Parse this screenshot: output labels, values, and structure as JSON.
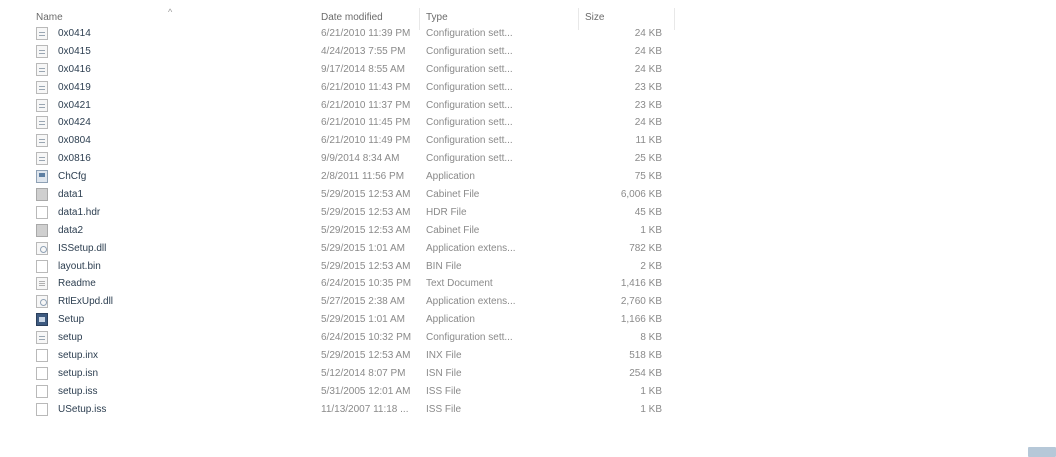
{
  "header": {
    "name": "Name",
    "date_modified": "Date modified",
    "type": "Type",
    "size": "Size",
    "sort_indicator": "^"
  },
  "files": [
    {
      "name": "0x0414",
      "date": "6/21/2010 11:39 PM",
      "type": "Configuration sett...",
      "size": "24 KB",
      "icon": "cfg"
    },
    {
      "name": "0x0415",
      "date": "4/24/2013 7:55 PM",
      "type": "Configuration sett...",
      "size": "24 KB",
      "icon": "cfg"
    },
    {
      "name": "0x0416",
      "date": "9/17/2014 8:55 AM",
      "type": "Configuration sett...",
      "size": "24 KB",
      "icon": "cfg"
    },
    {
      "name": "0x0419",
      "date": "6/21/2010 11:43 PM",
      "type": "Configuration sett...",
      "size": "23 KB",
      "icon": "cfg"
    },
    {
      "name": "0x0421",
      "date": "6/21/2010 11:37 PM",
      "type": "Configuration sett...",
      "size": "23 KB",
      "icon": "cfg"
    },
    {
      "name": "0x0424",
      "date": "6/21/2010 11:45 PM",
      "type": "Configuration sett...",
      "size": "24 KB",
      "icon": "cfg"
    },
    {
      "name": "0x0804",
      "date": "6/21/2010 11:49 PM",
      "type": "Configuration sett...",
      "size": "11 KB",
      "icon": "cfg"
    },
    {
      "name": "0x0816",
      "date": "9/9/2014 8:34 AM",
      "type": "Configuration sett...",
      "size": "25 KB",
      "icon": "cfg"
    },
    {
      "name": "ChCfg",
      "date": "2/8/2011 11:56 PM",
      "type": "Application",
      "size": "75 KB",
      "icon": "app"
    },
    {
      "name": "data1",
      "date": "5/29/2015 12:53 AM",
      "type": "Cabinet File",
      "size": "6,006 KB",
      "icon": "cab"
    },
    {
      "name": "data1.hdr",
      "date": "5/29/2015 12:53 AM",
      "type": "HDR File",
      "size": "45 KB",
      "icon": "blank"
    },
    {
      "name": "data2",
      "date": "5/29/2015 12:53 AM",
      "type": "Cabinet File",
      "size": "1 KB",
      "icon": "cab"
    },
    {
      "name": "ISSetup.dll",
      "date": "5/29/2015 1:01 AM",
      "type": "Application extens...",
      "size": "782 KB",
      "icon": "dll"
    },
    {
      "name": "layout.bin",
      "date": "5/29/2015 12:53 AM",
      "type": "BIN File",
      "size": "2 KB",
      "icon": "blank"
    },
    {
      "name": "Readme",
      "date": "6/24/2015 10:35 PM",
      "type": "Text Document",
      "size": "1,416 KB",
      "icon": "txt"
    },
    {
      "name": "RtlExUpd.dll",
      "date": "5/27/2015 2:38 AM",
      "type": "Application extens...",
      "size": "2,760 KB",
      "icon": "dll"
    },
    {
      "name": "Setup",
      "date": "5/29/2015 1:01 AM",
      "type": "Application",
      "size": "1,166 KB",
      "icon": "setup"
    },
    {
      "name": "setup",
      "date": "6/24/2015 10:32 PM",
      "type": "Configuration sett...",
      "size": "8 KB",
      "icon": "cfg"
    },
    {
      "name": "setup.inx",
      "date": "5/29/2015 12:53 AM",
      "type": "INX File",
      "size": "518 KB",
      "icon": "blank"
    },
    {
      "name": "setup.isn",
      "date": "5/12/2014 8:07 PM",
      "type": "ISN File",
      "size": "254 KB",
      "icon": "blank"
    },
    {
      "name": "setup.iss",
      "date": "5/31/2005 12:01 AM",
      "type": "ISS File",
      "size": "1 KB",
      "icon": "blank"
    },
    {
      "name": "USetup.iss",
      "date": "11/13/2007 11:18 ...",
      "type": "ISS File",
      "size": "1 KB",
      "icon": "blank"
    }
  ]
}
